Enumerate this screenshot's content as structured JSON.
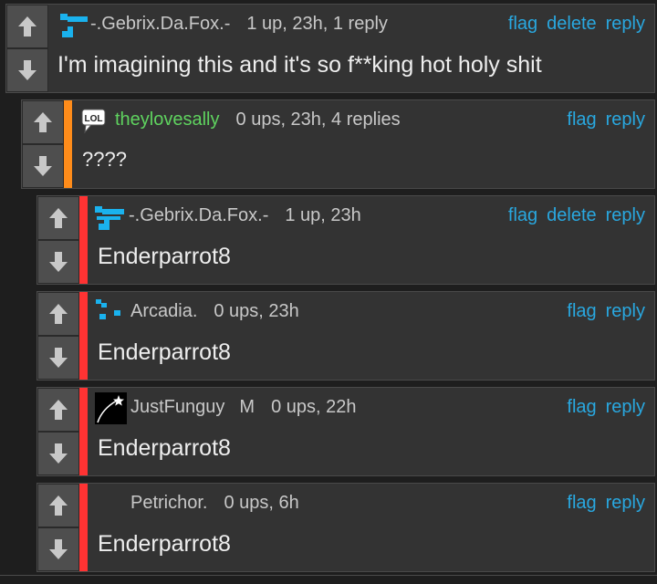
{
  "icons": {
    "up": "arrow-up-icon",
    "down": "arrow-down-icon"
  },
  "colors": {
    "link": "#29a8e0",
    "depth_level2": "#ff8c1a",
    "depth_level3": "#ff3333",
    "green_user": "#5fd35f"
  },
  "comments": [
    {
      "username": "-.Gebrix.Da.Fox.-",
      "meta": "1 up, 23h, 1 reply",
      "flag": "flag",
      "delete": "delete",
      "reply": "reply",
      "body": "I'm imagining this and it's so f**king hot holy shit"
    },
    {
      "avatar_text": "LOL",
      "username": "theylovesally",
      "meta": "0 ups, 23h, 4 replies",
      "flag": "flag",
      "reply": "reply",
      "body": "????"
    },
    {
      "username": "-.Gebrix.Da.Fox.-",
      "meta": "1 up, 23h",
      "flag": "flag",
      "delete": "delete",
      "reply": "reply",
      "body": "Enderparrot8"
    },
    {
      "username": "Arcadia.",
      "meta": "0 ups, 23h",
      "flag": "flag",
      "reply": "reply",
      "body": "Enderparrot8"
    },
    {
      "username": "JustFunguy",
      "mark": "M",
      "meta": "0 ups, 22h",
      "flag": "flag",
      "reply": "reply",
      "body": "Enderparrot8"
    },
    {
      "username": "Petrichor.",
      "meta": "0 ups, 6h",
      "flag": "flag",
      "reply": "reply",
      "body": "Enderparrot8"
    }
  ]
}
